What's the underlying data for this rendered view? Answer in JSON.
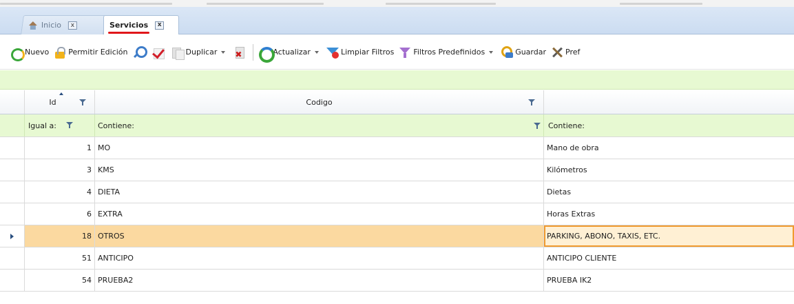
{
  "tabs": [
    {
      "label": "Inicio",
      "active": false,
      "icon": "home-icon"
    },
    {
      "label": "Servicios",
      "active": true
    }
  ],
  "tab_close_glyph": "x",
  "toolbar": {
    "nuevo": "Nuevo",
    "permitir_edicion": "Permitir Edición",
    "duplicar": "Duplicar",
    "actualizar": "Actualizar",
    "limpiar_filtros": "Limpiar Filtros",
    "filtros_predefinidos": "Filtros Predefinidos",
    "guardar": "Guardar",
    "preferencias": "Pref"
  },
  "grid": {
    "headers": {
      "id": "Id",
      "codigo": "Codigo",
      "descripcion": ""
    },
    "filter_row": {
      "id": "Igual a:",
      "codigo": "Contiene:",
      "descripcion": "Contiene:"
    },
    "rows": [
      {
        "id": "1",
        "codigo": "MO",
        "descripcion": "Mano de obra",
        "selected": false
      },
      {
        "id": "3",
        "codigo": "KMS",
        "descripcion": "Kilómetros",
        "selected": false
      },
      {
        "id": "4",
        "codigo": "DIETA",
        "descripcion": "Dietas",
        "selected": false
      },
      {
        "id": "6",
        "codigo": "EXTRA",
        "descripcion": "Horas Extras",
        "selected": false
      },
      {
        "id": "18",
        "codigo": "OTROS",
        "descripcion": "PARKING, ABONO, TAXIS, ETC.",
        "selected": true
      },
      {
        "id": "51",
        "codigo": "ANTICIPO",
        "descripcion": "ANTICIPO CLIENTE",
        "selected": false
      },
      {
        "id": "54",
        "codigo": "PRUEBA2",
        "descripcion": "PRUEBA IK2",
        "selected": false
      }
    ]
  },
  "colors": {
    "selection_row": "#fbd9a0",
    "selection_border": "#f09a2e",
    "filter_bg": "#e7f9d2",
    "tab_underline": "#e0161a"
  }
}
